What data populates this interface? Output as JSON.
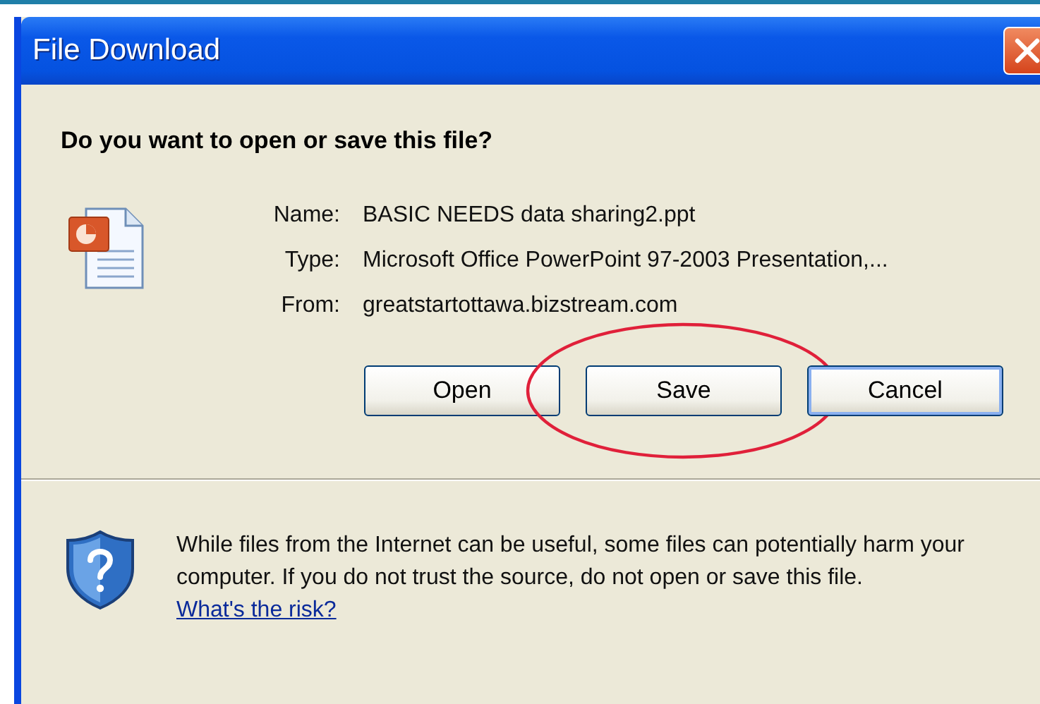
{
  "window": {
    "title": "File Download"
  },
  "question": "Do you want to open or save this file?",
  "file_info": [
    {
      "label": "Name:",
      "value": "BASIC NEEDS data sharing2.ppt"
    },
    {
      "label": "Type:",
      "value": "Microsoft Office PowerPoint 97-2003 Presentation,..."
    },
    {
      "label": "From:",
      "value": "greatstartottawa.bizstream.com"
    }
  ],
  "buttons": [
    {
      "label": "Open",
      "default": false,
      "highlighted": false
    },
    {
      "label": "Save",
      "default": false,
      "highlighted": true
    },
    {
      "label": "Cancel",
      "default": true,
      "highlighted": false
    }
  ],
  "warning": {
    "text": "While files from the Internet can be useful, some files can potentially harm your computer. If you do not trust the source, do not open or save this file.",
    "link": "What's the risk?"
  }
}
